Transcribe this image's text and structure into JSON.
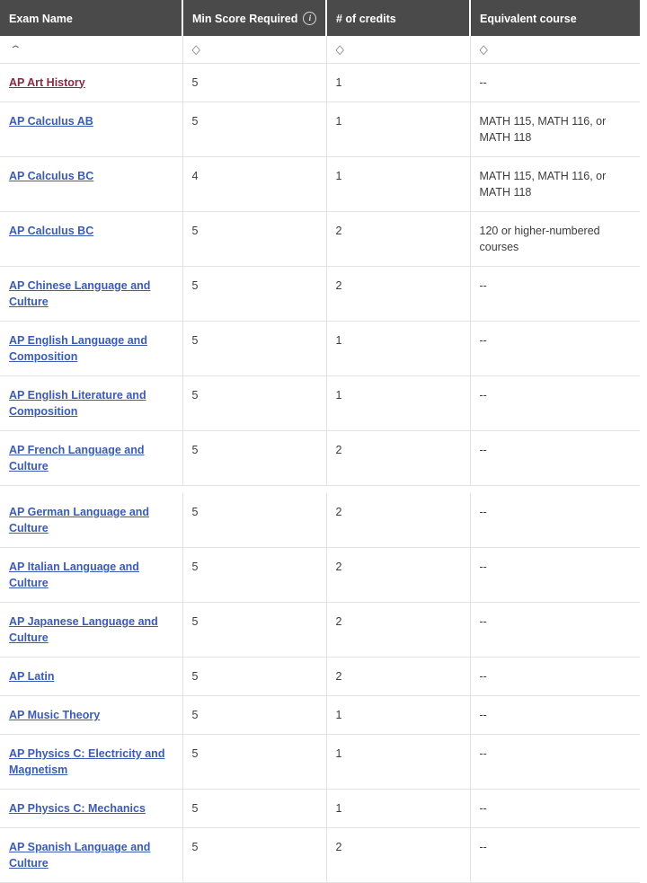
{
  "table": {
    "columns": [
      {
        "key": "exam",
        "label": "Exam Name",
        "has_info_icon": false,
        "sort": "asc",
        "sort_glyph": "⌃"
      },
      {
        "key": "score",
        "label": "Min Score Required",
        "has_info_icon": true,
        "info_icon": "info-icon",
        "info_glyph": "i",
        "sort": "none",
        "sort_glyph": "◇"
      },
      {
        "key": "cred",
        "label": "# of credits",
        "has_info_icon": false,
        "sort": "none",
        "sort_glyph": "◇"
      },
      {
        "key": "equiv",
        "label": "Equivalent course",
        "has_info_icon": false,
        "sort": "none",
        "sort_glyph": "◇"
      }
    ],
    "colors": {
      "header_bg": "#4a4a4a",
      "header_text": "#ffffff",
      "link": "#3b5bb5",
      "link_visited": "#8b2942",
      "cell_text": "#3c3c3c",
      "border": "#e3e3e3"
    },
    "rows": [
      {
        "exam": "AP Art History",
        "visited": true,
        "score": "5",
        "cred": "1",
        "equiv": "--"
      },
      {
        "exam": "AP Calculus AB",
        "visited": false,
        "score": "5",
        "cred": "1",
        "equiv": "MATH 115, MATH 116, or MATH 118"
      },
      {
        "exam": "AP Calculus BC",
        "visited": false,
        "score": "4",
        "cred": "1",
        "equiv": "MATH 115, MATH 116, or MATH 118"
      },
      {
        "exam": "AP Calculus BC",
        "visited": false,
        "score": "5",
        "cred": "2",
        "equiv": "120 or higher-numbered courses"
      },
      {
        "exam": "AP Chinese Language and Culture",
        "visited": false,
        "score": "5",
        "cred": "2",
        "equiv": "--"
      },
      {
        "exam": "AP English Language and Composition",
        "visited": false,
        "score": "5",
        "cred": "1",
        "equiv": "--"
      },
      {
        "exam": "AP English Literature and Composition",
        "visited": false,
        "score": "5",
        "cred": "1",
        "equiv": "--"
      },
      {
        "exam": "AP French Language and Culture",
        "visited": false,
        "score": "5",
        "cred": "2",
        "equiv": "--",
        "gap_after": true
      },
      {
        "exam": "AP German Language and Culture",
        "visited": false,
        "score": "5",
        "cred": "2",
        "equiv": "--"
      },
      {
        "exam": "AP Italian Language and Culture",
        "visited": false,
        "score": "5",
        "cred": "2",
        "equiv": "--"
      },
      {
        "exam": "AP Japanese Language and Culture",
        "visited": false,
        "score": "5",
        "cred": "2",
        "equiv": "--"
      },
      {
        "exam": "AP Latin",
        "visited": false,
        "score": "5",
        "cred": "2",
        "equiv": "--"
      },
      {
        "exam": "AP Music Theory",
        "visited": false,
        "score": "5",
        "cred": "1",
        "equiv": "--"
      },
      {
        "exam": "AP Physics C: Electricity and Magnetism",
        "visited": false,
        "score": "5",
        "cred": "1",
        "equiv": "--"
      },
      {
        "exam": "AP Physics C: Mechanics",
        "visited": false,
        "score": "5",
        "cred": "1",
        "equiv": "--"
      },
      {
        "exam": "AP Spanish Language and Culture",
        "visited": false,
        "score": "5",
        "cred": "2",
        "equiv": "--"
      }
    ]
  }
}
